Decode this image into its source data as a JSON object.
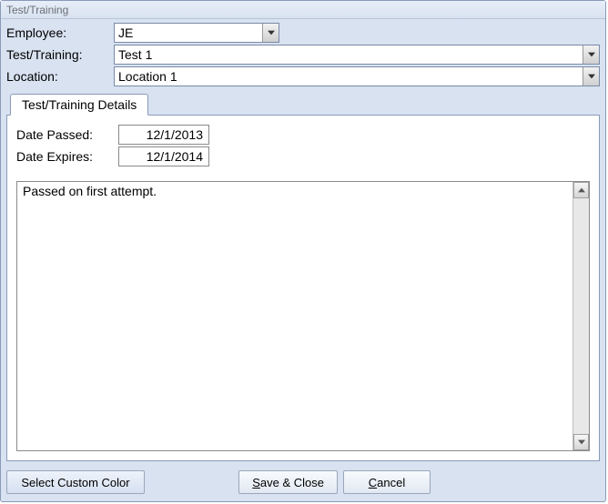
{
  "window": {
    "title": "Test/Training"
  },
  "header": {
    "employee_label": "Employee:",
    "employee_value": "JE",
    "testtraining_label": "Test/Training:",
    "testtraining_value": "Test 1",
    "location_label": "Location:",
    "location_value": "Location 1"
  },
  "tab": {
    "label": "Test/Training Details"
  },
  "details": {
    "date_passed_label": "Date Passed:",
    "date_passed_value": "12/1/2013",
    "date_expires_label": "Date Expires:",
    "date_expires_value": "12/1/2014",
    "notes": "Passed on first attempt."
  },
  "footer": {
    "select_color": "Select Custom Color",
    "save_prefix": "S",
    "save_rest": "ave & Close",
    "cancel_prefix": "C",
    "cancel_rest": "ancel"
  }
}
